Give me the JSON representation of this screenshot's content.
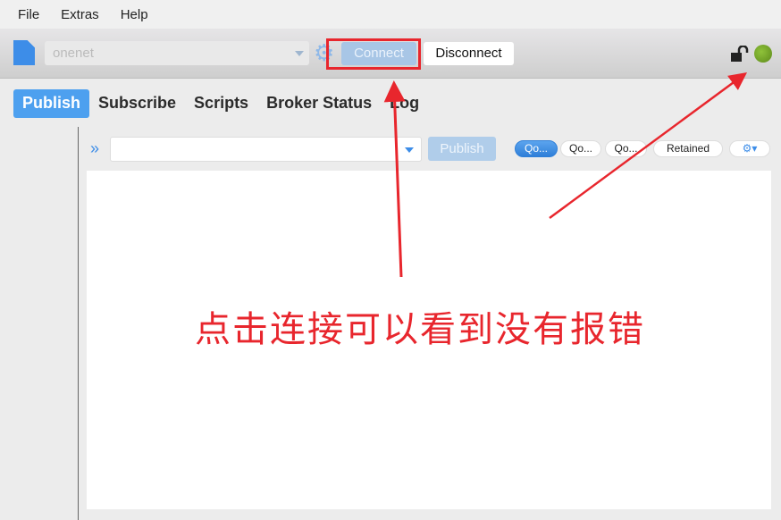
{
  "menu": [
    "File",
    "Extras",
    "Help"
  ],
  "toolbar": {
    "profile": "onenet",
    "connect": "Connect",
    "disconnect": "Disconnect",
    "status_color": "#7aab2a"
  },
  "tabs": [
    "Publish",
    "Subscribe",
    "Scripts",
    "Broker Status",
    "Log"
  ],
  "publish": {
    "topic": "",
    "publish_label": "Publish",
    "qos": [
      "Qo...",
      "Qo...",
      "Qo..."
    ],
    "retained": "Retained",
    "options_icon": "gears-icon"
  },
  "annotation": {
    "text": "点击连接可以看到没有报错",
    "color": "#e8262d"
  }
}
